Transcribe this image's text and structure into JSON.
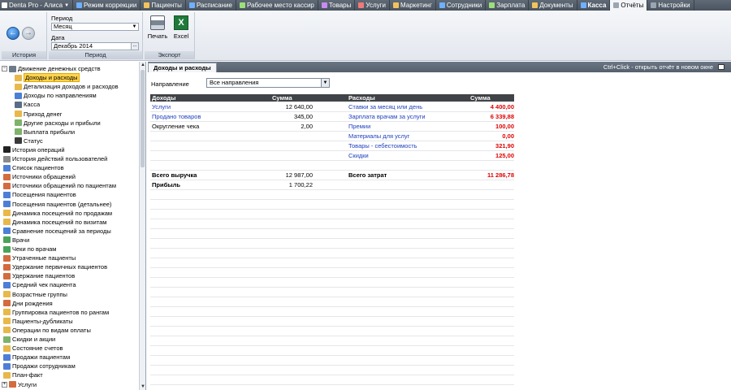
{
  "topbar": {
    "tabs": [
      {
        "label": "Denta Pro - Алиса",
        "dropdown": true,
        "color": "#ffffff"
      },
      {
        "label": "Режим коррекции",
        "color": "#6fb0ff"
      },
      {
        "label": "Пациенты",
        "color": "#f2c35c"
      },
      {
        "label": "Расписание",
        "color": "#6fb0ff"
      },
      {
        "label": "Рабочее место кассир",
        "color": "#9be07a"
      },
      {
        "label": "Товары",
        "color": "#c98bf0"
      },
      {
        "label": "Услуги",
        "color": "#f07a7a"
      },
      {
        "label": "Маркетинг",
        "color": "#f2c35c"
      },
      {
        "label": "Сотрудники",
        "color": "#6fb0ff"
      },
      {
        "label": "Зарплата",
        "color": "#9be07a"
      },
      {
        "label": "Документы",
        "color": "#f2c35c"
      },
      {
        "label": "Касса",
        "color": "#6fb0ff",
        "bold": true
      },
      {
        "label": "Отчёты",
        "color": "#9aa5b1",
        "active": true
      },
      {
        "label": "Настройки",
        "color": "#9aa5b1"
      }
    ]
  },
  "ribbon": {
    "history": {
      "caption": "История"
    },
    "period": {
      "caption": "Период",
      "period_label": "Период",
      "period_value": "Месяц",
      "date_label": "Дата",
      "date_value": "Декабрь 2014"
    },
    "export": {
      "caption": "Экспорт",
      "print_label": "Печать",
      "excel_label": "Excel"
    }
  },
  "tree": {
    "items": [
      {
        "label": "Движение денежных средств",
        "level": 0,
        "expander": "-",
        "color": "#6c7a8a"
      },
      {
        "label": "Доходы и расходы",
        "level": 1,
        "selected": true,
        "color": "#e8b84a"
      },
      {
        "label": "Детализация доходов и расходов",
        "level": 1,
        "color": "#e8b84a"
      },
      {
        "label": "Доходы по направлениям",
        "level": 1,
        "color": "#4d7fd6"
      },
      {
        "label": "Касса",
        "level": 1,
        "color": "#5a6d86"
      },
      {
        "label": "Приход денег",
        "level": 1,
        "color": "#e8b84a"
      },
      {
        "label": "Другие расходы и прибыли",
        "level": 1,
        "color": "#7db36a"
      },
      {
        "label": "Выплата прибыли",
        "level": 1,
        "color": "#7db36a"
      },
      {
        "label": "Статус",
        "level": 1,
        "color": "#3a3a3a"
      },
      {
        "label": "История операций",
        "level": 0,
        "color": "#222222"
      },
      {
        "label": "История действий пользователей",
        "level": 0,
        "color": "#8a8a8a"
      },
      {
        "label": "Список пациентов",
        "level": 0,
        "color": "#4d7fd6"
      },
      {
        "label": "Источники обращений",
        "level": 0,
        "color": "#d36b3f"
      },
      {
        "label": "Источники обращений по пациентам",
        "level": 0,
        "color": "#d36b3f"
      },
      {
        "label": "Посещения пациентов",
        "level": 0,
        "color": "#4d7fd6"
      },
      {
        "label": "Посещения пациентов (детальнее)",
        "level": 0,
        "color": "#4d7fd6"
      },
      {
        "label": "Динамика посещений по продажам",
        "level": 0,
        "color": "#e8b84a"
      },
      {
        "label": "Динамика посещений по визитам",
        "level": 0,
        "color": "#e8b84a"
      },
      {
        "label": "Сравнение посещений за периоды",
        "level": 0,
        "color": "#4d7fd6"
      },
      {
        "label": "Врачи",
        "level": 0,
        "color": "#4aa35a"
      },
      {
        "label": "Чеки по врачам",
        "level": 0,
        "color": "#4aa35a"
      },
      {
        "label": "Утраченные пациенты",
        "level": 0,
        "color": "#d36b3f"
      },
      {
        "label": "Удержание первичных пациентов",
        "level": 0,
        "color": "#d36b3f"
      },
      {
        "label": "Удержание пациентов",
        "level": 0,
        "color": "#d36b3f"
      },
      {
        "label": "Средний чек пациента",
        "level": 0,
        "color": "#4d7fd6"
      },
      {
        "label": "Возрастные группы",
        "level": 0,
        "color": "#e8b84a"
      },
      {
        "label": "Дни рождения",
        "level": 0,
        "color": "#d36b3f"
      },
      {
        "label": "Группировка пациентов по рангам",
        "level": 0,
        "color": "#e8b84a"
      },
      {
        "label": "Пациенты-дубликаты",
        "level": 0,
        "color": "#e8b84a"
      },
      {
        "label": "Операции по видам оплаты",
        "level": 0,
        "color": "#e8b84a"
      },
      {
        "label": "Скидки и акции",
        "level": 0,
        "color": "#7db36a"
      },
      {
        "label": "Состояние счетов",
        "level": 0,
        "color": "#e8b84a"
      },
      {
        "label": "Продажи пациентам",
        "level": 0,
        "color": "#4d7fd6"
      },
      {
        "label": "Продажи сотрудникам",
        "level": 0,
        "color": "#4d7fd6"
      },
      {
        "label": "План-факт",
        "level": 0,
        "color": "#e8b84a"
      },
      {
        "label": "Услуги",
        "level": 0,
        "expander": "+",
        "color": "#d36b3f"
      }
    ]
  },
  "content": {
    "tab_label": "Доходы и расходы",
    "hint": "Ctrl+Click - открыть отчёт в новом окне",
    "direction_label": "Направление",
    "direction_value": "Все направления",
    "report": {
      "headers": {
        "income": "Доходы",
        "income_sum": "Сумма",
        "expense": "Расходы",
        "expense_sum": "Сумма"
      },
      "rows": [
        {
          "income": "Услуги",
          "income_sum": "12 640,00",
          "expense": "Ставки за месяц или день",
          "expense_sum": "4 400,00",
          "income_link": true
        },
        {
          "income": "Продано товаров",
          "income_sum": "345,00",
          "expense": "Зарплата врачам за услуги",
          "expense_sum": "6 339,88",
          "income_link": true
        },
        {
          "income": "Округление чека",
          "income_sum": "2,00",
          "expense": "Премии",
          "expense_sum": "100,00",
          "income_link": false
        },
        {
          "income": "",
          "income_sum": "",
          "expense": "Материалы для услуг",
          "expense_sum": "0,00"
        },
        {
          "income": "",
          "income_sum": "",
          "expense": "Товары - себестоимость",
          "expense_sum": "321,90"
        },
        {
          "income": "",
          "income_sum": "",
          "expense": "Скидки",
          "expense_sum": "125,00"
        }
      ],
      "total_income_label": "Всего выручка",
      "total_income": "12 987,00",
      "total_expense_label": "Всего затрат",
      "total_expense": "11 286,78",
      "profit_label": "Прибыль",
      "profit": "1 700,22"
    }
  }
}
